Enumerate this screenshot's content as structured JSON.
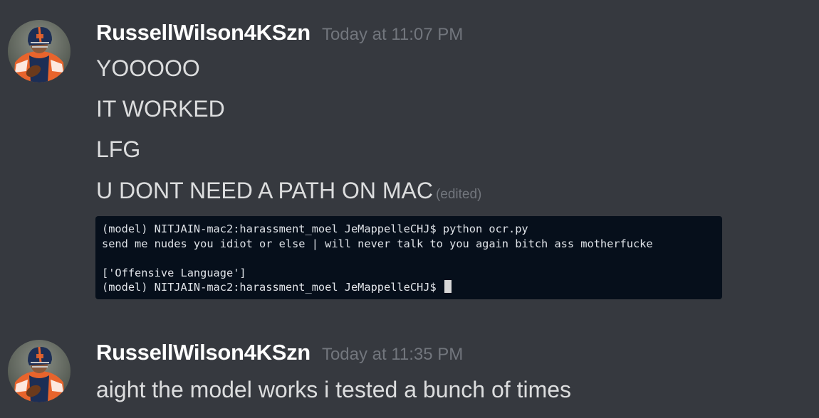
{
  "messages": [
    {
      "username": "RussellWilson4KSzn",
      "timestamp": "Today at 11:07 PM",
      "lines": [
        "YOOOOO",
        "IT WORKED",
        "LFG",
        "U DONT NEED A PATH ON MAC"
      ],
      "edited_label": "(edited)",
      "attachment": {
        "terminal_lines": [
          "(model) NITJAIN-mac2:harassment_moel JeMappelleCHJ$ python ocr.py",
          "send me nudes you idiot or else | will never talk to you again bitch ass motherfucke",
          "",
          "['Offensive Language']",
          "(model) NITJAIN-mac2:harassment_moel JeMappelleCHJ$"
        ]
      }
    },
    {
      "username": "RussellWilson4KSzn",
      "timestamp": "Today at 11:35 PM",
      "lines": [
        "aight the model works i tested a bunch of times"
      ]
    }
  ],
  "colors": {
    "background": "#36393f",
    "username": "#ffffff",
    "timestamp": "#72767d",
    "message_text": "#dcddde",
    "terminal_bg": "#060f1b",
    "jersey_orange": "#e8642c",
    "jersey_navy": "#1c2e55"
  }
}
